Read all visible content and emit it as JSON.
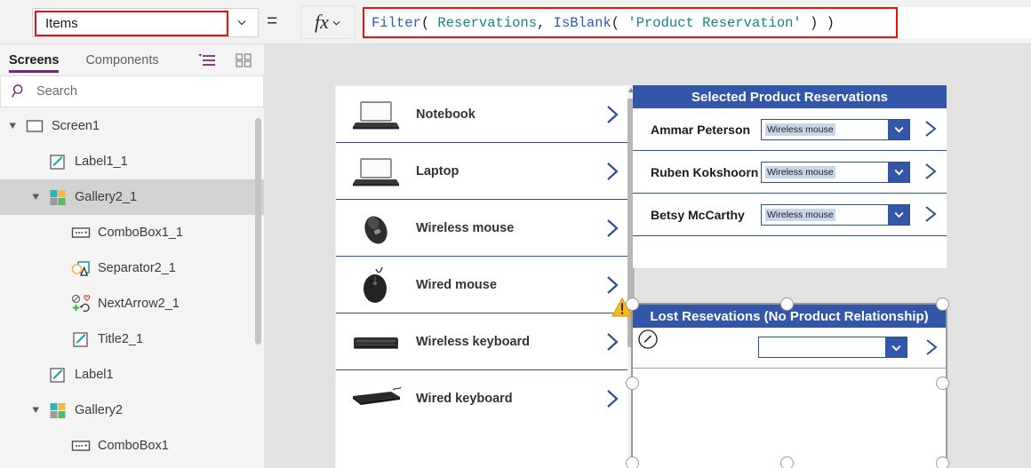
{
  "formula_bar": {
    "property_value": "Items",
    "property_placeholder": "Items",
    "equals_sign": "=",
    "fx_label": "fx",
    "formula_tokens": [
      {
        "text": "Filter",
        "type": "fn"
      },
      {
        "text": "( ",
        "type": "pun"
      },
      {
        "text": "Reservations",
        "type": "src"
      },
      {
        "text": ", ",
        "type": "pun"
      },
      {
        "text": "IsBlank",
        "type": "fn"
      },
      {
        "text": "( ",
        "type": "pun"
      },
      {
        "text": "'Product Reservation'",
        "type": "str"
      },
      {
        "text": " ) )",
        "type": "pun"
      }
    ],
    "formula_text": "Filter( Reservations, IsBlank( 'Product Reservation' ) )",
    "colors": {
      "function": "#2f5ab5",
      "source": "#1b8186",
      "string": "#1b8186",
      "punctuation": "#1b1b1b",
      "outline": "#e8110e"
    }
  },
  "left_panel": {
    "tabs": [
      {
        "label": "Screens",
        "active": true
      },
      {
        "label": "Components",
        "active": false
      }
    ],
    "icons": {
      "tree_toggle": "tree-view-icon",
      "thumbnail": "thumbnail-view-icon",
      "search": "search-icon"
    },
    "search": {
      "placeholder": "Search",
      "value": ""
    },
    "accent_color": "#742774",
    "tree": [
      {
        "label": "Screen1",
        "icon": "screen-icon",
        "indent": 0,
        "caret": "expanded",
        "selected": false
      },
      {
        "label": "Label1_1",
        "icon": "label-icon",
        "indent": 1,
        "caret": "none",
        "selected": false
      },
      {
        "label": "Gallery2_1",
        "icon": "gallery-icon",
        "indent": 1,
        "caret": "expanded",
        "selected": true
      },
      {
        "label": "ComboBox1_1",
        "icon": "combobox-icon",
        "indent": 2,
        "caret": "none",
        "selected": false
      },
      {
        "label": "Separator2_1",
        "icon": "separator-icon",
        "indent": 2,
        "caret": "none",
        "selected": false
      },
      {
        "label": "NextArrow2_1",
        "icon": "nextarrow-icon",
        "indent": 2,
        "caret": "none",
        "selected": false
      },
      {
        "label": "Title2_1",
        "icon": "label-icon",
        "indent": 2,
        "caret": "none",
        "selected": false
      },
      {
        "label": "Label1",
        "icon": "label-icon",
        "indent": 1,
        "caret": "none",
        "selected": false
      },
      {
        "label": "Gallery2",
        "icon": "gallery-icon",
        "indent": 1,
        "caret": "expanded",
        "selected": false
      },
      {
        "label": "ComboBox1",
        "icon": "combobox-icon",
        "indent": 2,
        "caret": "none",
        "selected": false
      }
    ]
  },
  "canvas": {
    "background_color": "#e2e2e2",
    "product_gallery": {
      "name": "product-list-gallery",
      "rows": [
        {
          "label": "Notebook",
          "image": "notebook-image"
        },
        {
          "label": "Laptop",
          "image": "laptop-image"
        },
        {
          "label": "Wireless mouse",
          "image": "wireless-mouse-image"
        },
        {
          "label": "Wired mouse",
          "image": "wired-mouse-image"
        },
        {
          "label": "Wireless keyboard",
          "image": "wireless-keyboard-image"
        },
        {
          "label": "Wired keyboard",
          "image": "wired-keyboard-image"
        }
      ]
    },
    "selected_reservations": {
      "title": "Selected Product Reservations",
      "header_color": "#3356a8",
      "rows": [
        {
          "name": "Ammar Peterson",
          "combo_value": "Wireless mouse"
        },
        {
          "name": "Ruben Kokshoorn",
          "combo_value": "Wireless mouse"
        },
        {
          "name": "Betsy McCarthy",
          "combo_value": "Wireless mouse"
        }
      ]
    },
    "lost_reservations": {
      "title": "Lost Resevations (No Product Relationship)",
      "header_color": "#3356a8",
      "selected": true,
      "rows": [
        {
          "name": "",
          "combo_value": ""
        }
      ],
      "warning_icon": "warning-triangle-icon",
      "edit_badge_icon": "edit-pencil-icon"
    }
  }
}
